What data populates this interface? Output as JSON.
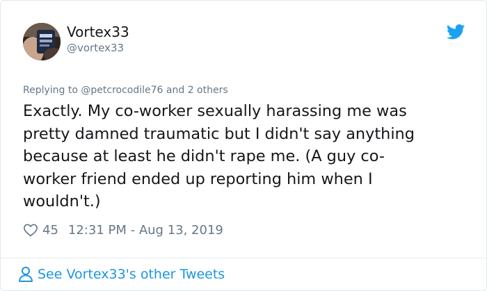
{
  "author": {
    "display_name": "Vortex33",
    "handle": "@vortex33"
  },
  "reply_context": {
    "prefix": "Replying to",
    "mention": "@petcrocodile76",
    "suffix": "and 2 others"
  },
  "tweet": {
    "lines": [
      "Exactly. My co-worker sexually harassing me was",
      "pretty damned traumatic but I didn't say anything",
      "because at least he didn't rape me. (A guy co-",
      "worker friend ended up reporting him when I",
      "wouldn't.)"
    ]
  },
  "meta": {
    "likes": "45",
    "timestamp": "12:31 PM - Aug 13, 2019"
  },
  "footer": {
    "see_more": "See Vortex33's other Tweets"
  },
  "colors": {
    "text": "#14171a",
    "secondary": "#657786",
    "link": "#1b95e0",
    "twitter_blue": "#1da1f2",
    "border": "#e1e8ed"
  },
  "icons": {
    "brand": "twitter-bird-icon",
    "like": "heart-icon",
    "profile": "person-icon"
  }
}
